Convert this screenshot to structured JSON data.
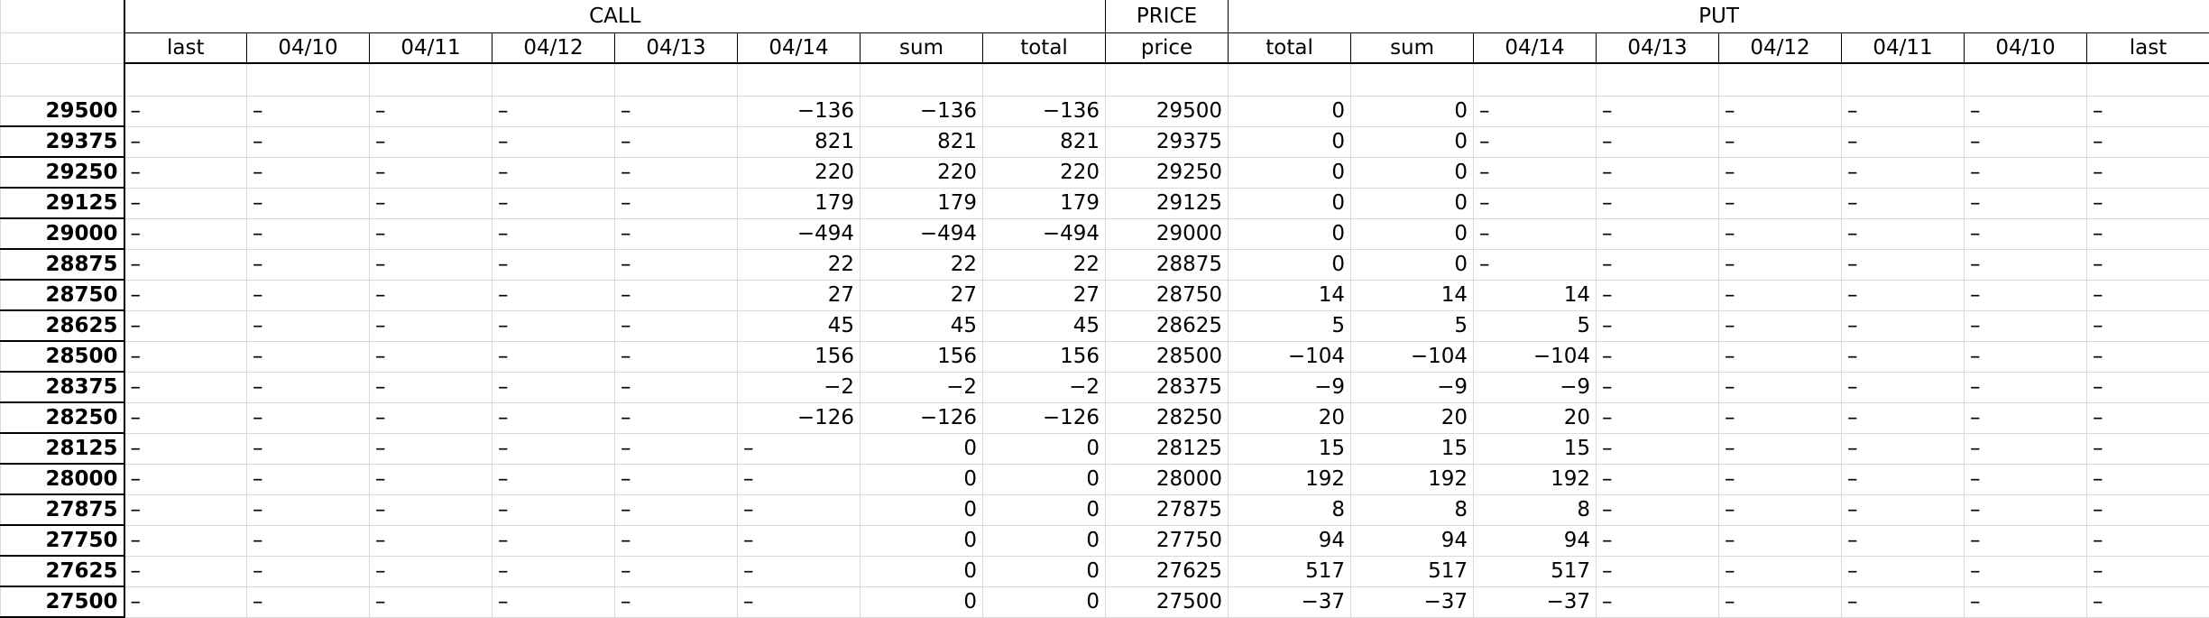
{
  "header": {
    "groups": {
      "call": "CALL",
      "price": "PRICE",
      "put": "PUT"
    },
    "call_columns": [
      "last",
      "04/10",
      "04/11",
      "04/12",
      "04/13",
      "04/14",
      "sum",
      "total"
    ],
    "price_column": "price",
    "put_columns": [
      "total",
      "sum",
      "04/14",
      "04/13",
      "04/12",
      "04/11",
      "04/10",
      "last"
    ]
  },
  "rows": [
    {
      "strike": "29500",
      "call": [
        "–",
        "–",
        "–",
        "–",
        "–",
        "−136",
        "−136",
        "−136"
      ],
      "price": "29500",
      "put": [
        "0",
        "0",
        "–",
        "–",
        "–",
        "–",
        "–",
        "–"
      ]
    },
    {
      "strike": "29375",
      "call": [
        "–",
        "–",
        "–",
        "–",
        "–",
        "821",
        "821",
        "821"
      ],
      "price": "29375",
      "put": [
        "0",
        "0",
        "–",
        "–",
        "–",
        "–",
        "–",
        "–"
      ]
    },
    {
      "strike": "29250",
      "call": [
        "–",
        "–",
        "–",
        "–",
        "–",
        "220",
        "220",
        "220"
      ],
      "price": "29250",
      "put": [
        "0",
        "0",
        "–",
        "–",
        "–",
        "–",
        "–",
        "–"
      ]
    },
    {
      "strike": "29125",
      "call": [
        "–",
        "–",
        "–",
        "–",
        "–",
        "179",
        "179",
        "179"
      ],
      "price": "29125",
      "put": [
        "0",
        "0",
        "–",
        "–",
        "–",
        "–",
        "–",
        "–"
      ]
    },
    {
      "strike": "29000",
      "call": [
        "–",
        "–",
        "–",
        "–",
        "–",
        "−494",
        "−494",
        "−494"
      ],
      "price": "29000",
      "put": [
        "0",
        "0",
        "–",
        "–",
        "–",
        "–",
        "–",
        "–"
      ]
    },
    {
      "strike": "28875",
      "call": [
        "–",
        "–",
        "–",
        "–",
        "–",
        "22",
        "22",
        "22"
      ],
      "price": "28875",
      "put": [
        "0",
        "0",
        "–",
        "–",
        "–",
        "–",
        "–",
        "–"
      ]
    },
    {
      "strike": "28750",
      "call": [
        "–",
        "–",
        "–",
        "–",
        "–",
        "27",
        "27",
        "27"
      ],
      "price": "28750",
      "put": [
        "14",
        "14",
        "14",
        "–",
        "–",
        "–",
        "–",
        "–"
      ]
    },
    {
      "strike": "28625",
      "call": [
        "–",
        "–",
        "–",
        "–",
        "–",
        "45",
        "45",
        "45"
      ],
      "price": "28625",
      "put": [
        "5",
        "5",
        "5",
        "–",
        "–",
        "–",
        "–",
        "–"
      ]
    },
    {
      "strike": "28500",
      "call": [
        "–",
        "–",
        "–",
        "–",
        "–",
        "156",
        "156",
        "156"
      ],
      "price": "28500",
      "put": [
        "−104",
        "−104",
        "−104",
        "–",
        "–",
        "–",
        "–",
        "–"
      ]
    },
    {
      "strike": "28375",
      "call": [
        "–",
        "–",
        "–",
        "–",
        "–",
        "−2",
        "−2",
        "−2"
      ],
      "price": "28375",
      "put": [
        "−9",
        "−9",
        "−9",
        "–",
        "–",
        "–",
        "–",
        "–"
      ]
    },
    {
      "strike": "28250",
      "call": [
        "–",
        "–",
        "–",
        "–",
        "–",
        "−126",
        "−126",
        "−126"
      ],
      "price": "28250",
      "put": [
        "20",
        "20",
        "20",
        "–",
        "–",
        "–",
        "–",
        "–"
      ]
    },
    {
      "strike": "28125",
      "call": [
        "–",
        "–",
        "–",
        "–",
        "–",
        "–",
        "0",
        "0"
      ],
      "price": "28125",
      "put": [
        "15",
        "15",
        "15",
        "–",
        "–",
        "–",
        "–",
        "–"
      ]
    },
    {
      "strike": "28000",
      "call": [
        "–",
        "–",
        "–",
        "–",
        "–",
        "–",
        "0",
        "0"
      ],
      "price": "28000",
      "put": [
        "192",
        "192",
        "192",
        "–",
        "–",
        "–",
        "–",
        "–"
      ]
    },
    {
      "strike": "27875",
      "call": [
        "–",
        "–",
        "–",
        "–",
        "–",
        "–",
        "0",
        "0"
      ],
      "price": "27875",
      "put": [
        "8",
        "8",
        "8",
        "–",
        "–",
        "–",
        "–",
        "–"
      ]
    },
    {
      "strike": "27750",
      "call": [
        "–",
        "–",
        "–",
        "–",
        "–",
        "–",
        "0",
        "0"
      ],
      "price": "27750",
      "put": [
        "94",
        "94",
        "94",
        "–",
        "–",
        "–",
        "–",
        "–"
      ]
    },
    {
      "strike": "27625",
      "call": [
        "–",
        "–",
        "–",
        "–",
        "–",
        "–",
        "0",
        "0"
      ],
      "price": "27625",
      "put": [
        "517",
        "517",
        "517",
        "–",
        "–",
        "–",
        "–",
        "–"
      ]
    },
    {
      "strike": "27500",
      "call": [
        "–",
        "–",
        "–",
        "–",
        "–",
        "–",
        "0",
        "0"
      ],
      "price": "27500",
      "put": [
        "−37",
        "−37",
        "−37",
        "–",
        "–",
        "–",
        "–",
        "–"
      ]
    }
  ]
}
